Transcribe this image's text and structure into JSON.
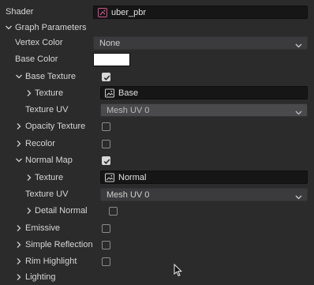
{
  "shader": {
    "label": "Shader",
    "value": "uber_pbr"
  },
  "graph_parameters": {
    "label": "Graph Parameters"
  },
  "vertex_color": {
    "label": "Vertex Color",
    "value": "None"
  },
  "base_color": {
    "label": "Base Color",
    "color": "#ffffff"
  },
  "base_texture": {
    "label": "Base Texture",
    "checked": true,
    "texture_label": "Texture",
    "texture_value": "Base",
    "uv_label": "Texture UV",
    "uv_value": "Mesh UV 0"
  },
  "opacity_texture": {
    "label": "Opacity Texture",
    "checked": false
  },
  "recolor": {
    "label": "Recolor",
    "checked": false
  },
  "normal_map": {
    "label": "Normal Map",
    "checked": true,
    "texture_label": "Texture",
    "texture_value": "Normal",
    "uv_label": "Texture UV",
    "uv_value": "Mesh UV 0",
    "detail_label": "Detail Normal",
    "detail_checked": false
  },
  "emissive": {
    "label": "Emissive",
    "checked": false
  },
  "simple_reflection": {
    "label": "Simple Reflection",
    "checked": false
  },
  "rim_highlight": {
    "label": "Rim Highlight",
    "checked": false
  },
  "lighting": {
    "label": "Lighting"
  },
  "colors": {
    "background": "#2b2b2c",
    "field_dark": "#161617",
    "dropdown": "#3b3b3d",
    "dropdown_disabled": "#4a4a4c",
    "text": "#d6d6d6",
    "shader_icon": "#d0558a"
  },
  "icons": {
    "shader": "shader-graph-icon",
    "texture": "image-icon",
    "expand": "chevron-right-icon",
    "collapse": "chevron-down-icon",
    "dropdown": "chevron-down-icon"
  }
}
